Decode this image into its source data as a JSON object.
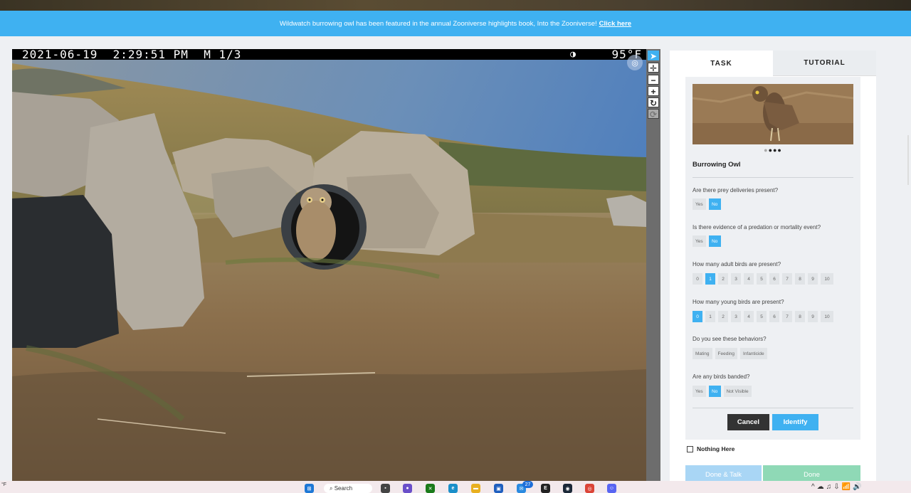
{
  "banner": {
    "text": "Wildwatch burrowing owl has been featured in the annual Zooniverse highlights book, Into the Zooniverse!",
    "link": "Click here"
  },
  "camera": {
    "date": "2021-06-19",
    "time": "2:29:51 PM",
    "mode": "M 1/3",
    "moon": "◑",
    "temp": "95°F"
  },
  "toolbar": {
    "items": [
      {
        "icon": "pointer-icon",
        "glyph": "➤"
      },
      {
        "icon": "move-icon",
        "glyph": "✛"
      },
      {
        "icon": "zoom-out-icon",
        "glyph": "−"
      },
      {
        "icon": "zoom-in-icon",
        "glyph": "+"
      },
      {
        "icon": "rotate-icon",
        "glyph": "↻"
      },
      {
        "icon": "reset-icon",
        "glyph": "⟳"
      }
    ]
  },
  "tabs": {
    "task": "TASK",
    "tutorial": "TUTORIAL"
  },
  "species": {
    "name": "Burrowing Owl"
  },
  "questions": {
    "prey": {
      "label": "Are there prey deliveries present?",
      "options": [
        "Yes",
        "No"
      ]
    },
    "predation": {
      "label": "Is there evidence of a predation or mortality event?",
      "options": [
        "Yes",
        "No"
      ]
    },
    "adults": {
      "label": "How many adult birds are present?",
      "options": [
        "0",
        "1",
        "2",
        "3",
        "4",
        "5",
        "6",
        "7",
        "8",
        "9",
        "10"
      ]
    },
    "young": {
      "label": "How many young birds are present?",
      "options": [
        "0",
        "1",
        "2",
        "3",
        "4",
        "5",
        "6",
        "7",
        "8",
        "9",
        "10"
      ]
    },
    "behaviors": {
      "label": "Do you see these behaviors?",
      "options": [
        "Mating",
        "Feeding",
        "Infanticide"
      ]
    },
    "banded": {
      "label": "Are any birds banded?",
      "options": [
        "Yes",
        "No",
        "Not Visible"
      ]
    }
  },
  "buttons": {
    "cancel": "Cancel",
    "identify": "Identify",
    "done_talk": "Done & Talk",
    "done": "Done"
  },
  "nothing_here": "Nothing Here",
  "taskbar": {
    "weather": "°F",
    "search": "Search",
    "badge": "27"
  }
}
